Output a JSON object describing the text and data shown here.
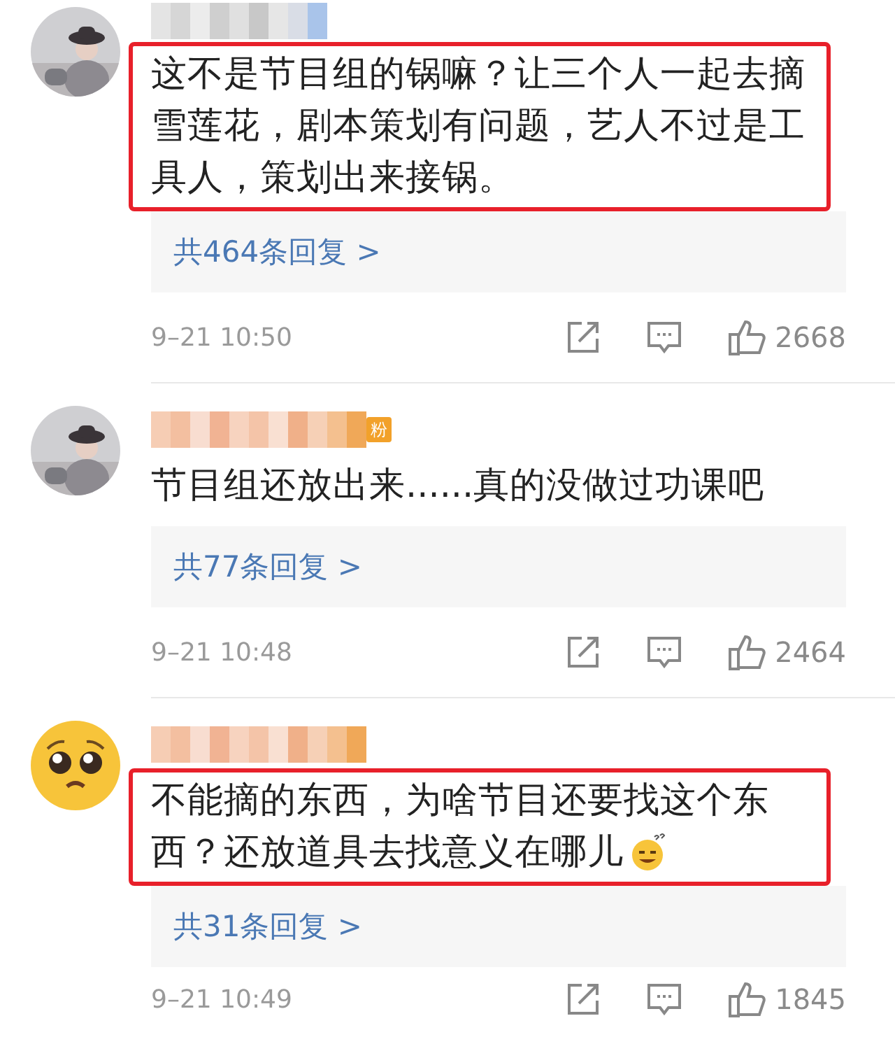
{
  "comments": [
    {
      "highlighted": true,
      "text": "这不是节目组的锅嘛？让三个人一起去摘雪莲花，剧本策划有问题，艺人不过是工具人，策划出来接锅。",
      "emoji": false,
      "replies": "共464条回复 >",
      "time": "9–21 10:50",
      "likes": "2668"
    },
    {
      "badge": "粉",
      "highlighted": false,
      "text": "节目组还放出来......真的没做过功课吧",
      "emoji": false,
      "replies": "共77条回复 >",
      "time": "9–21 10:48",
      "likes": "2464"
    },
    {
      "avatar": {
        "kind": "emoji"
      },
      "highlighted": true,
      "text": "不能摘的东西，为啥节目还要找这个东西？还放道具去找意义在哪儿",
      "emoji": true,
      "replies": "共31条回复 >",
      "time": "9–21 10:49",
      "likes": "1845"
    }
  ]
}
